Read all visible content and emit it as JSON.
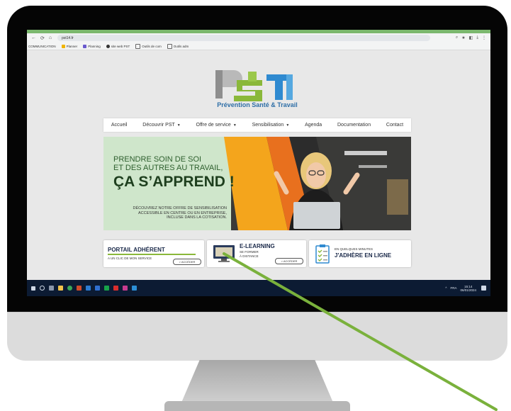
{
  "browser": {
    "url": "pst14.fr",
    "bookmarks": [
      "COMMUNICATION",
      "Planner",
      "Planning",
      "site web PST",
      "Outils de com",
      "Outils adm"
    ]
  },
  "site": {
    "logo_letters": "PST",
    "tagline": "Prévention Santé & Travail",
    "nav": [
      {
        "label": "Accueil",
        "dropdown": false
      },
      {
        "label": "Découvrir PST",
        "dropdown": true
      },
      {
        "label": "Offre de service",
        "dropdown": true
      },
      {
        "label": "Sensibilisation",
        "dropdown": true
      },
      {
        "label": "Agenda",
        "dropdown": false
      },
      {
        "label": "Documentation",
        "dropdown": false
      },
      {
        "label": "Contact",
        "dropdown": false
      }
    ],
    "hero": {
      "line1a": "PRENDRE SOIN DE SOI",
      "line1b": "ET DES AUTRES AU TRAVAIL,",
      "line2": "ÇA S’APPREND !",
      "sub1": "DÉCOUVREZ NOTRE OFFRE DE SENSIBILISATION",
      "sub2": "ACCESSIBLE EN CENTRE OU EN ENTREPRISE,",
      "sub3": "INCLUSE DANS LA COTISATION."
    },
    "cards": {
      "portail_title": "PORTAIL ADHÉRENT",
      "portail_sub": "A UN CLIC DE MON SERVICE",
      "portail_btn": "> ACCÉDER",
      "elearning_title": "E-LEARNING",
      "elearning_sub1": "SE FORMER",
      "elearning_sub2": "À DISTANCE",
      "elearning_btn": "> ACCÉDER",
      "adhere_sub": "EN QUELQUES MINUTES",
      "adhere_title": "J'ADHÈRE EN LIGNE"
    }
  },
  "taskbar": {
    "lang": "FRA",
    "time": "15:14",
    "date": "06/01/2024"
  },
  "colors": {
    "brand_green": "#8ab83a",
    "brand_blue": "#2f8ad0",
    "brand_gray": "#8e8e8e",
    "pointer": "#7ab13c"
  }
}
